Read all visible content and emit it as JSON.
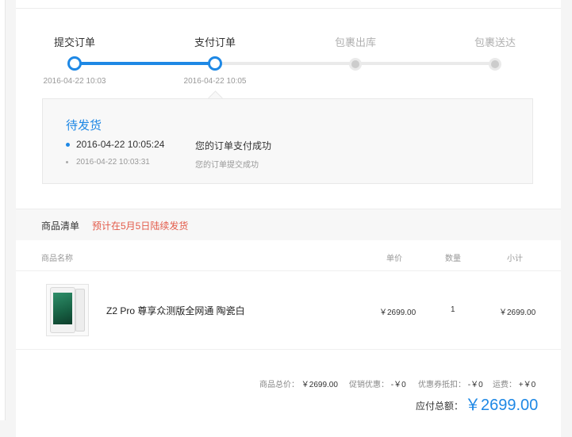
{
  "progress": {
    "steps": [
      {
        "label": "提交订单",
        "time": "2016-04-22 10:03"
      },
      {
        "label": "支付订单",
        "time": "2016-04-22 10:05"
      },
      {
        "label": "包裹出库",
        "time": ""
      },
      {
        "label": "包裹送达",
        "time": ""
      }
    ],
    "completed_fraction": 0.333
  },
  "status": {
    "title": "待发货",
    "logs": [
      {
        "time": "2016-04-22 10:05:24",
        "message": "您的订单支付成功"
      },
      {
        "time": "2016-04-22 10:03:31",
        "message": "您的订单提交成功"
      }
    ]
  },
  "goods": {
    "title": "商品清单",
    "notice": "预计在5月5日陆续发货",
    "columns": {
      "name": "商品名称",
      "price": "单价",
      "qty": "数量",
      "subtotal": "小计"
    },
    "items": [
      {
        "name": "Z2 Pro 尊享众测版全网通 陶瓷白",
        "price": "￥2699.00",
        "qty": "1",
        "subtotal": "￥2699.00"
      }
    ]
  },
  "summary": {
    "goods_total_label": "商品总价：",
    "goods_total": "￥2699.00",
    "promo_label": "促销优惠：",
    "promo": "-￥0",
    "coupon_label": "优惠券抵扣：",
    "coupon": "-￥0",
    "shipping_label": "运费：",
    "shipping": "+￥0",
    "payable_label": "应付总额：",
    "payable": "￥2699.00"
  },
  "colors": {
    "accent": "#1e88e5",
    "notice": "#e35b4a"
  }
}
